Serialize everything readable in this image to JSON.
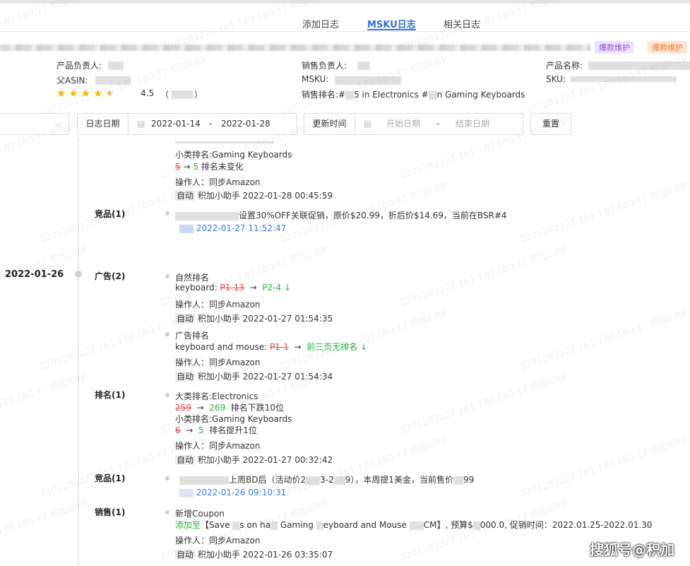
{
  "tabs": [
    {
      "label": "添加日志"
    },
    {
      "label": "MSKU日志",
      "active": true
    },
    {
      "label": "相关日志"
    }
  ],
  "tags": [
    {
      "label": "爆款维护",
      "color": "#8a4fe0",
      "bg": "#efe4fb"
    },
    {
      "label": "爆款维护",
      "color": "#f07a2a",
      "bg": "#fde6d6"
    }
  ],
  "info": {
    "product_owner_label": "产品负责人:",
    "parent_asin_label": "父ASIN:",
    "rating": "4.5",
    "rating_count_open": "（",
    "rating_count_close": "）",
    "sales_owner_label": "销售负责人:",
    "msku_label": "MSKU:",
    "sales_rank_label": "销售排名:",
    "sales_rank_text_1": "#",
    "sales_rank_text_2": "5 in Electronics #",
    "sales_rank_text_3": "n Gaming Keyboards",
    "product_name_label": "产品名称:",
    "sku_label": "SKU:"
  },
  "filters": {
    "log_date_label": "日志日期",
    "log_date_start": "2022-01-14",
    "log_date_end": "2022-01-28",
    "separator": "-",
    "update_time_label": "更新时间",
    "start_placeholder": "开始日期",
    "end_placeholder": "结束日期",
    "reset_label": "重置"
  },
  "timeline": {
    "date_2": "2022-01-26",
    "e0": {
      "l1": "小类排名:Gaming Keyboards",
      "old": "5",
      "arrow": "→",
      "new": "5",
      "note": "排名未变化",
      "operator": "操作人：同步Amazon",
      "auto": "自动",
      "meta": "积加小助手 2022-01-28 00:45:59"
    },
    "c1": {
      "category": "竞品(1)",
      "text": "设置30%OFF关联促销，原价$20.99，折后价$14.69，当前在BSR#4",
      "time": "2022-01-27 11:52:47"
    },
    "c2": {
      "category": "广告(2)",
      "a1": {
        "title": "自然排名",
        "kw": "keyboard:",
        "old": "P1-13",
        "arrow": "→",
        "new": "P2-4 ↓",
        "operator": "操作人：同步Amazon",
        "auto": "自动",
        "meta": "积加小助手 2022-01-27 01:54:35"
      },
      "a2": {
        "title": "广告排名",
        "kw": "keyboard and mouse:",
        "old": "P1-1",
        "arrow": "→",
        "new": "前三页无排名 ↓",
        "operator": "操作人：同步Amazon",
        "auto": "自动",
        "meta": "积加小助手 2022-01-27 01:54:34"
      }
    },
    "c3": {
      "category": "排名(1)",
      "l1": "大类排名:Electronics",
      "old1": "259",
      "arrow": "→",
      "new1": "269",
      "note1": "排名下跌10位",
      "l2": "小类排名:Gaming Keyboards",
      "old2": "6",
      "new2": "5",
      "note2": "排名提升1位",
      "operator": "操作人：同步Amazon",
      "auto": "自动",
      "meta": "积加小助手 2022-01-27 00:32:42"
    },
    "c4": {
      "category": "竞品(1)",
      "text_a": "上周BD后（活动价2",
      "text_b": "3-2",
      "text_c": "9），本周提1美金，当前售价",
      "text_d": "99",
      "time": "2022-01-26 09:10:31"
    },
    "c5": {
      "category": "销售(1)",
      "title": "新增Coupon",
      "added": "添加至",
      "t1": "【Save ",
      "t2": "s on ha",
      "t3": " Gaming ",
      "t4": "eyboard and Mouse ",
      "t5": "CM】, 预算$",
      "t6": "000.0, 促销时间：2022.01.25-2022.01.30",
      "operator": "操作人：同步Amazon",
      "auto": "自动",
      "meta": "积加小助手 2022-01-26 03:35:07"
    }
  },
  "watermark": "2201282227 161.189.180.17 积加ERP",
  "sohu_logo": "搜狐号@积加"
}
